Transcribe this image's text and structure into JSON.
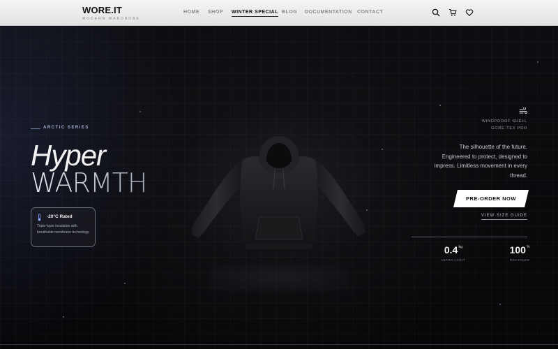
{
  "brand": {
    "logo": "WORE.IT",
    "tagline": "MODERN WARDROBE"
  },
  "nav": {
    "items": [
      {
        "label": "HOME",
        "active": false
      },
      {
        "label": "SHOP",
        "active": false
      },
      {
        "label": "WINTER SPECIAL",
        "active": true
      },
      {
        "label": "BLOG",
        "active": false
      },
      {
        "label": "DOCUMENTATION",
        "active": false
      },
      {
        "label": "CONTACT",
        "active": false
      }
    ],
    "icons": [
      "search-icon",
      "cart-icon",
      "heart-icon"
    ]
  },
  "hero": {
    "series": "ARCTIC SERIES",
    "title_line1": "Hyper",
    "title_line2": "WARMTH",
    "feature_card": {
      "icon": "thermometer-icon",
      "title": "-20°C Rated",
      "description": "Triple-layer insulation with breathable membrane technology."
    },
    "specs": {
      "icon": "wind-icon",
      "line1": "WINDPROOF SHELL",
      "line2": "GORE-TEX PRO"
    },
    "blurb": "The silhouette of the future. Engineered to protect, designed to impress. Limitless movement in every thread.",
    "cta": "PRE-ORDER NOW",
    "size_guide": "VIEW SIZE GUIDE",
    "stats": [
      {
        "value": "0.4",
        "unit": "kg",
        "label": "ULTRA LIGHT"
      },
      {
        "value": "100",
        "unit": "%",
        "label": "RECYCLED"
      }
    ]
  },
  "colors": {
    "accent": "#a8b4d2",
    "cta_bg": "#ffffff",
    "background": "#0b0b0e"
  }
}
